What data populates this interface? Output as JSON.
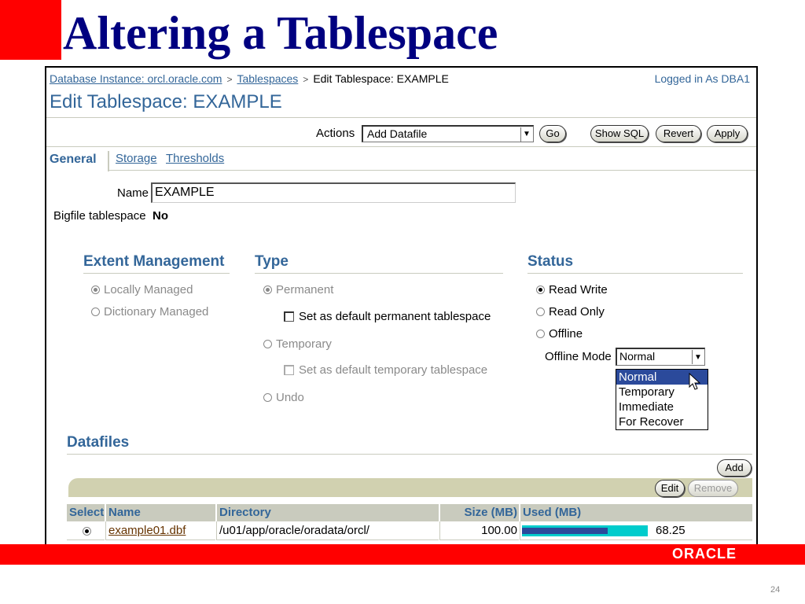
{
  "slide": {
    "title": "Altering a Tablespace",
    "page_number": "24",
    "logo": "ORACLE"
  },
  "breadcrumb": {
    "instance": "Database Instance: orcl.oracle.com",
    "tablespaces": "Tablespaces",
    "current": "Edit Tablespace: EXAMPLE",
    "sep": ">"
  },
  "logged_in": "Logged in As DBA1",
  "page_title": "Edit Tablespace: EXAMPLE",
  "actions": {
    "label": "Actions",
    "selected": "Add Datafile",
    "go": "Go",
    "show_sql": "Show SQL",
    "revert": "Revert",
    "apply": "Apply"
  },
  "tabs": {
    "general": "General",
    "storage": "Storage",
    "thresholds": "Thresholds"
  },
  "name": {
    "label": "Name",
    "value": "EXAMPLE"
  },
  "bigfile": {
    "label": "Bigfile tablespace",
    "value": "No"
  },
  "extent": {
    "heading": "Extent Management",
    "locally": "Locally Managed",
    "dictionary": "Dictionary Managed"
  },
  "type": {
    "heading": "Type",
    "permanent": "Permanent",
    "default_perm": "Set as default permanent tablespace",
    "temporary": "Temporary",
    "default_temp": "Set as default temporary tablespace",
    "undo": "Undo"
  },
  "status": {
    "heading": "Status",
    "read_write": "Read Write",
    "read_only": "Read Only",
    "offline": "Offline",
    "offline_mode_label": "Offline Mode",
    "offline_mode_value": "Normal",
    "options": [
      "Normal",
      "Temporary",
      "Immediate",
      "For Recover"
    ]
  },
  "datafiles": {
    "heading": "Datafiles",
    "add": "Add",
    "edit": "Edit",
    "remove": "Remove",
    "columns": [
      "Select",
      "Name",
      "Directory",
      "Size (MB)",
      "Used (MB)"
    ],
    "rows": [
      {
        "name": "example01.dbf",
        "directory": "/u01/app/oracle/oradata/orcl/",
        "size": "100.00",
        "used": "68.25",
        "used_fraction": 0.6825
      }
    ]
  },
  "colors": {
    "accent": "#336699",
    "brand_red": "#ff0000",
    "title_navy": "#000080",
    "used_bar": "#2b4a9b",
    "free_bar": "#00cccc"
  }
}
